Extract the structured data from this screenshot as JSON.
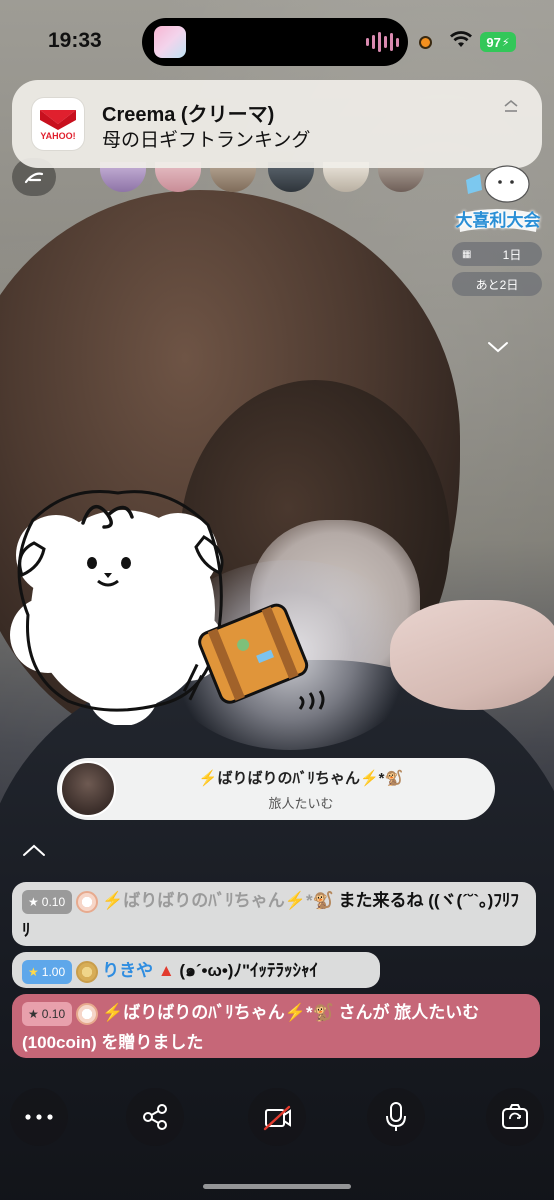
{
  "status_bar": {
    "time": "19:33",
    "battery": "97"
  },
  "notification": {
    "app": "Creema (クリーマ)",
    "body": "母の日ギフトランキング",
    "icon_text": "YAHOO!"
  },
  "event": {
    "title": "大喜利大会",
    "pill_day": "1日",
    "pill_remaining": "あと2日"
  },
  "gift_banner": {
    "user": "⚡️ばりばりのﾊﾞﾘちゃん⚡️*🐒",
    "item": "旅人たいむ"
  },
  "chat": [
    {
      "badge": "0.10",
      "user": "⚡️ばりばりのﾊﾞﾘちゃん⚡️*🐒",
      "text": "また来るね ((ヾ(´˘`｡)ﾌﾘﾌﾘ"
    },
    {
      "badge": "1.00",
      "user": "りきや",
      "text": "(๑´•ω•)ﾉ\"ｲｯﾃﾗｯｼｬｲ"
    },
    {
      "badge": "0.10",
      "user": "⚡️ばりばりのﾊﾞﾘちゃん⚡️*🐒",
      "text": "さんが 旅人たいむ (100coin) を贈りました"
    }
  ],
  "icons": [
    "more-icon",
    "share-icon",
    "camera-off-icon",
    "mic-icon",
    "flip-camera-icon",
    "chevron-up-icon",
    "chevron-down-icon",
    "menu-icon",
    "calendar-icon"
  ],
  "colors": {
    "gift_bubble": "#ce6a7c",
    "badge_blue": "#5ea7ea",
    "battery": "#33c759"
  }
}
